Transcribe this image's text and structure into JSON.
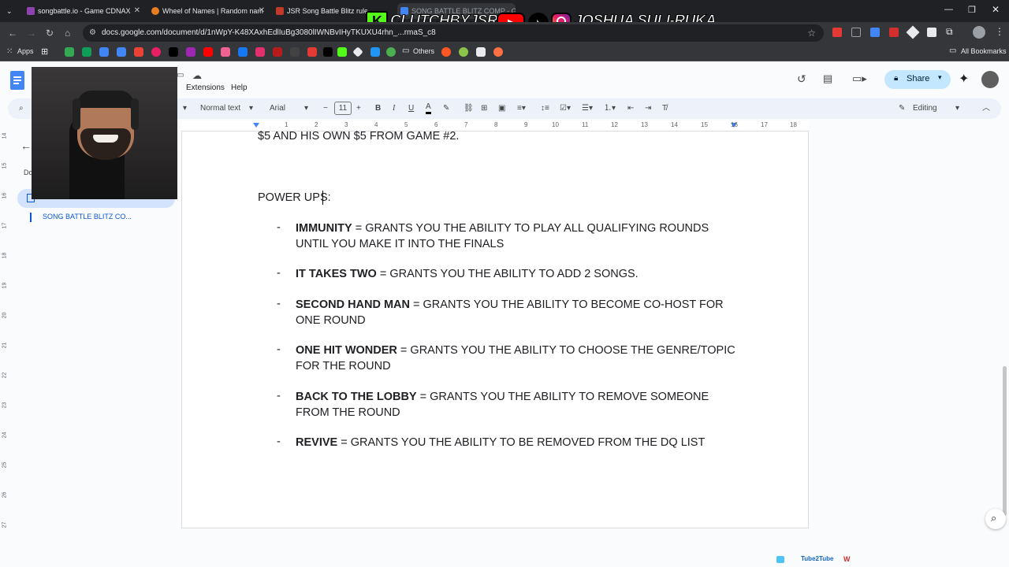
{
  "browser": {
    "tabs": [
      {
        "label": "songbattle.io - Game CDNAX",
        "color": "#8e44ad"
      },
      {
        "label": "Wheel of Names | Random nam",
        "color": "#e67e22"
      },
      {
        "label": "JSR Song Battle Blitz rules - Ch",
        "color": "#c0392b"
      },
      {
        "label": "SONG BATTLE BLITZ COMP - Go",
        "color": "#4285f4"
      }
    ],
    "url": "docs.google.com/document/d/1nWpY-K48XAxhEdlIuBg3080lIWNBvIHyTKUXU4rhn_...rmaS_c8",
    "bookmarks": {
      "apps": "Apps",
      "others": "Others",
      "all_bookmarks": "All Bookmarks"
    }
  },
  "banner": {
    "left": "CLUTCHBYJSR",
    "right": "JOSHUA SULI-RUKA"
  },
  "docs": {
    "menu_extensions": "Extensions",
    "menu_help": "Help",
    "share_label": "Share",
    "style_select": "Normal text",
    "font_select": "Arial",
    "font_size": "11",
    "mode_label": "Editing",
    "outline": {
      "doc_label": "Do",
      "heading": "SONG BATTLE BLITZ CO..."
    },
    "ruler_numbers": [
      "1",
      "2",
      "3",
      "4",
      "5",
      "6",
      "7",
      "8",
      "9",
      "10",
      "11",
      "12",
      "13",
      "14",
      "15",
      "16",
      "17",
      "18"
    ],
    "vruler_numbers": [
      "14",
      "15",
      "16",
      "17",
      "18",
      "19",
      "20",
      "21",
      "22",
      "23",
      "24",
      "25",
      "26",
      "27"
    ]
  },
  "document": {
    "top_line": "$5 AND HIS OWN $5 FROM GAME #2.",
    "section_title": "POWER UPS:",
    "items": [
      {
        "name": "IMMUNITY",
        "rest": " = GRANTS YOU THE ABILITY TO PLAY ALL QUALIFYING ROUNDS UNTIL YOU MAKE IT INTO THE FINALS"
      },
      {
        "name": "IT TAKES TWO",
        "rest": " = GRANTS YOU THE ABILITY TO ADD 2 SONGS."
      },
      {
        "name": "SECOND HAND MAN",
        "rest": " = GRANTS YOU THE ABILITY TO BECOME CO-HOST FOR ONE ROUND"
      },
      {
        "name": "ONE HIT WONDER",
        "rest": " = GRANTS YOU THE ABILITY TO CHOOSE THE GENRE/TOPIC FOR THE ROUND"
      },
      {
        "name": "BACK TO THE LOBBY",
        "rest": " = GRANTS YOU THE ABILITY TO REMOVE SOMEONE FROM THE ROUND"
      },
      {
        "name": "REVIVE",
        "rest": " = GRANTS YOU THE ABILITY TO BE REMOVED FROM THE DQ LIST"
      }
    ],
    "bullet": "-"
  },
  "footer_watermark": "Tube2Tube"
}
